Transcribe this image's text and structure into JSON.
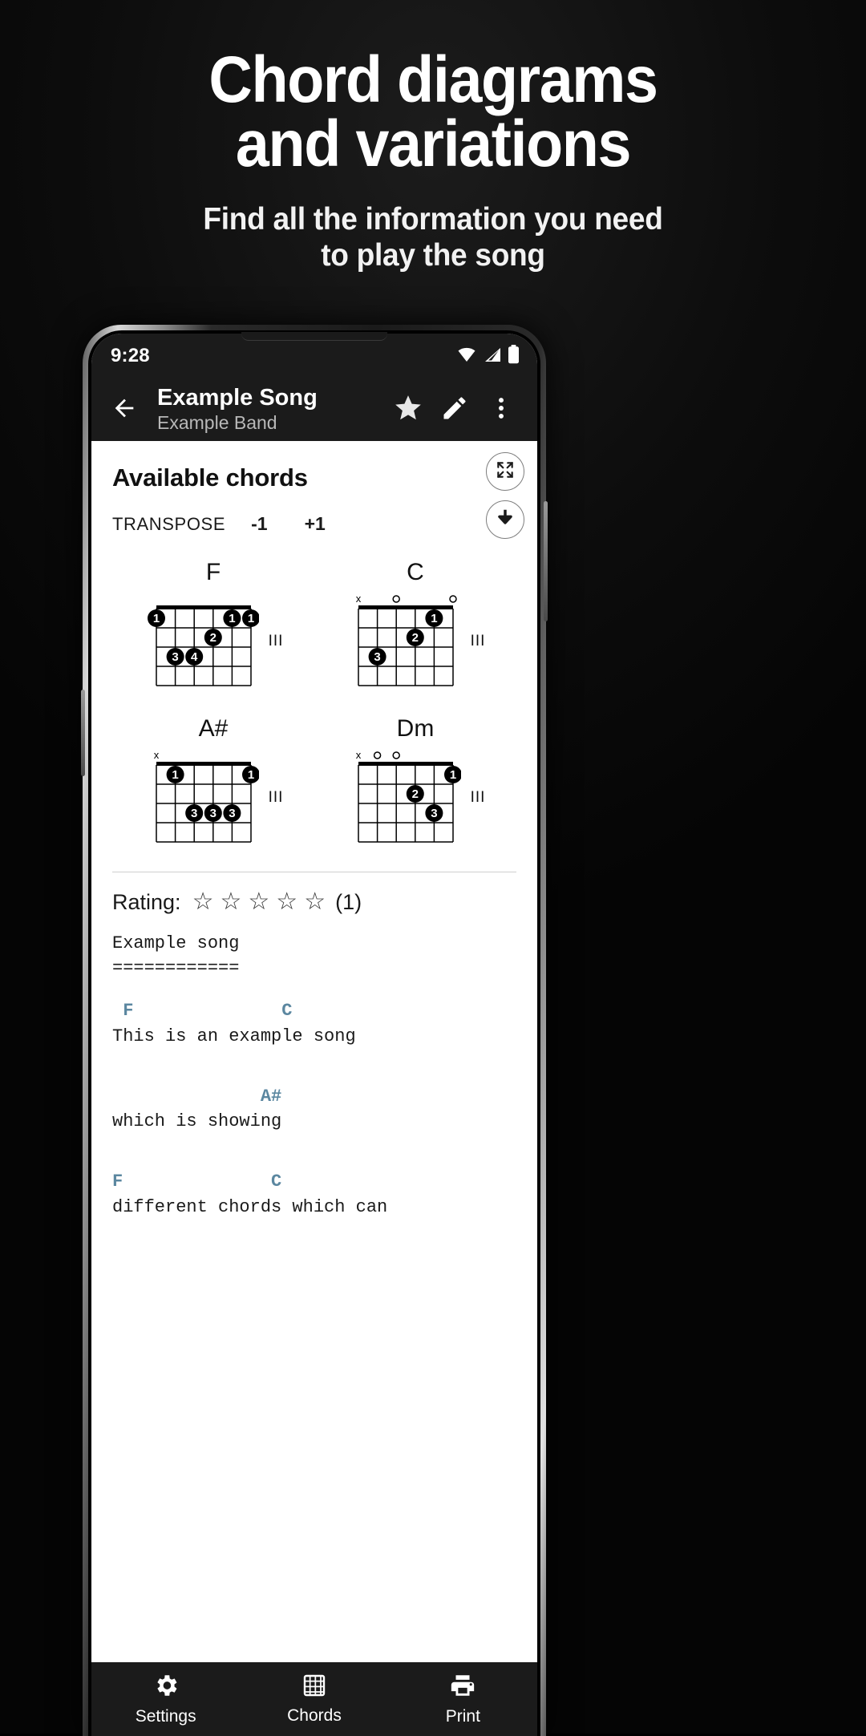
{
  "promo": {
    "headline_lines": [
      "Chord diagrams",
      "and variations"
    ],
    "subhead_lines": [
      "Find all the information you need",
      "to play the song"
    ],
    "background_color": "#0d0d0d",
    "text_color": "#ffffff"
  },
  "statusbar": {
    "clock": "9:28",
    "icons": [
      "wifi-icon",
      "signal-icon",
      "battery-icon"
    ]
  },
  "appbar": {
    "back_icon": "back-arrow-icon",
    "title": "Example Song",
    "artist": "Example Band",
    "actions": [
      {
        "name": "favorite-button",
        "icon": "star-filled-icon"
      },
      {
        "name": "edit-button",
        "icon": "pencil-icon"
      },
      {
        "name": "overflow-button",
        "icon": "more-vert-icon"
      }
    ],
    "background_color": "#1b1b1b"
  },
  "floating_actions": [
    {
      "name": "fullscreen-button",
      "icon": "fullscreen-expand-icon"
    },
    {
      "name": "download-button",
      "icon": "download-arrow-icon"
    }
  ],
  "chords_panel": {
    "title": "Available chords",
    "transpose_label": "TRANSPOSE",
    "transpose_down": "-1",
    "transpose_up": "+1",
    "chords": [
      {
        "name": "F",
        "fret_label": "III",
        "open_strings": [
          "",
          "",
          "",
          "",
          "",
          ""
        ],
        "dots": [
          {
            "string": 1,
            "fret": 1,
            "finger": "1"
          },
          {
            "string": 5,
            "fret": 1,
            "finger": "1"
          },
          {
            "string": 6,
            "fret": 1,
            "finger": "1"
          },
          {
            "string": 4,
            "fret": 2,
            "finger": "2"
          },
          {
            "string": 2,
            "fret": 3,
            "finger": "3"
          },
          {
            "string": 3,
            "fret": 3,
            "finger": "4"
          }
        ]
      },
      {
        "name": "C",
        "fret_label": "III",
        "open_strings": [
          "x",
          "",
          "o",
          "",
          "",
          "o"
        ],
        "dots": [
          {
            "string": 5,
            "fret": 1,
            "finger": "1"
          },
          {
            "string": 4,
            "fret": 2,
            "finger": "2"
          },
          {
            "string": 2,
            "fret": 3,
            "finger": "3"
          }
        ]
      },
      {
        "name": "A#",
        "fret_label": "III",
        "open_strings": [
          "x",
          "",
          "",
          "",
          "",
          ""
        ],
        "dots": [
          {
            "string": 2,
            "fret": 1,
            "finger": "1"
          },
          {
            "string": 6,
            "fret": 1,
            "finger": "1"
          },
          {
            "string": 3,
            "fret": 3,
            "finger": "3"
          },
          {
            "string": 4,
            "fret": 3,
            "finger": "3"
          },
          {
            "string": 5,
            "fret": 3,
            "finger": "3"
          }
        ]
      },
      {
        "name": "Dm",
        "fret_label": "III",
        "open_strings": [
          "x",
          "o",
          "o",
          "",
          "",
          ""
        ],
        "dots": [
          {
            "string": 6,
            "fret": 1,
            "finger": "1"
          },
          {
            "string": 4,
            "fret": 2,
            "finger": "2"
          },
          {
            "string": 5,
            "fret": 3,
            "finger": "3"
          }
        ]
      }
    ]
  },
  "rating": {
    "label": "Rating:",
    "stars": [
      "☆",
      "☆",
      "☆",
      "☆",
      "☆"
    ],
    "count": "(1)"
  },
  "lyrics": {
    "lines": [
      {
        "type": "text",
        "text": "Example song"
      },
      {
        "type": "text",
        "text": "============"
      },
      {
        "type": "blank",
        "text": ""
      },
      {
        "type": "chord",
        "text": " F              C"
      },
      {
        "type": "text",
        "text": "This is an example song"
      },
      {
        "type": "blank",
        "text": ""
      },
      {
        "type": "blank",
        "text": ""
      },
      {
        "type": "chord",
        "text": "              A#"
      },
      {
        "type": "text",
        "text": "which is showing"
      },
      {
        "type": "blank",
        "text": ""
      },
      {
        "type": "blank",
        "text": ""
      },
      {
        "type": "chord",
        "text": "F              C"
      },
      {
        "type": "text",
        "text": "different chords which can"
      }
    ],
    "chord_color": "#5b87a0"
  },
  "bottomnav": {
    "items": [
      {
        "label": "Settings",
        "icon": "gear-icon"
      },
      {
        "label": "Chords",
        "icon": "grid-chord-icon"
      },
      {
        "label": "Print",
        "icon": "printer-icon"
      }
    ],
    "background_color": "#1b1b1b"
  }
}
